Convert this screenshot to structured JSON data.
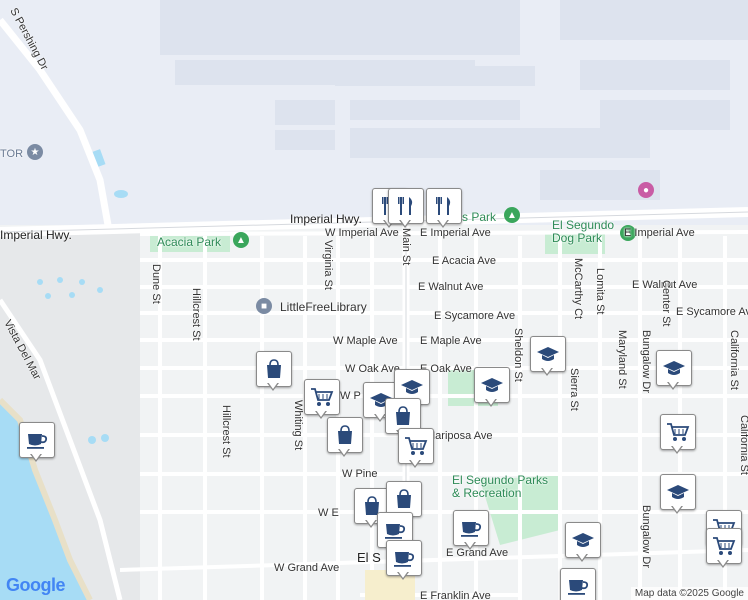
{
  "map": {
    "streets": [
      {
        "id": "s-pershing",
        "name": "S Pershing Dr"
      },
      {
        "id": "imperial-hwy-1",
        "name": "Imperial Hwy."
      },
      {
        "id": "imperial-hwy-2",
        "name": "Imperial Hwy."
      },
      {
        "id": "w-imperial-ave",
        "name": "W Imperial Ave"
      },
      {
        "id": "e-imperial-ave-1",
        "name": "E Imperial Ave"
      },
      {
        "id": "e-imperial-ave-2",
        "name": "E Imperial Ave"
      },
      {
        "id": "main-st",
        "name": "Main St"
      },
      {
        "id": "e-acacia-ave",
        "name": "E Acacia Ave"
      },
      {
        "id": "e-walnut-ave-1",
        "name": "E Walnut Ave"
      },
      {
        "id": "e-walnut-ave-2",
        "name": "E Walnut Ave"
      },
      {
        "id": "e-sycamore-ave-1",
        "name": "E Sycamore Ave"
      },
      {
        "id": "e-sycamore-ave-2",
        "name": "E Sycamore Ave"
      },
      {
        "id": "w-maple-ave",
        "name": "W Maple Ave"
      },
      {
        "id": "e-maple-ave",
        "name": "E Maple Ave"
      },
      {
        "id": "w-oak-ave",
        "name": "W Oak Ave"
      },
      {
        "id": "e-oak-ave",
        "name": "E Oak Ave"
      },
      {
        "id": "w-p",
        "name": "W P"
      },
      {
        "id": "mariposa-ave",
        "name": "Mariposa Ave"
      },
      {
        "id": "w-pine",
        "name": "W Pine"
      },
      {
        "id": "w-grand-ave",
        "name": "W Grand Ave"
      },
      {
        "id": "e-grand-ave",
        "name": "E Grand Ave"
      },
      {
        "id": "e-franklin-ave",
        "name": "E Franklin Ave"
      },
      {
        "id": "dune-st",
        "name": "Dune St"
      },
      {
        "id": "hillcrest-st-1",
        "name": "Hillcrest St"
      },
      {
        "id": "hillcrest-st-2",
        "name": "Hillcrest St"
      },
      {
        "id": "virginia-st",
        "name": "Virginia St"
      },
      {
        "id": "whiting-st",
        "name": "Whiting St"
      },
      {
        "id": "sheldon-st",
        "name": "Sheldon St"
      },
      {
        "id": "mccarthy-ct",
        "name": "McCarthy Ct"
      },
      {
        "id": "lomita-st",
        "name": "Lomita St"
      },
      {
        "id": "sierra-st",
        "name": "Sierra St"
      },
      {
        "id": "maryland-st",
        "name": "Maryland St"
      },
      {
        "id": "bungalow-dr-1",
        "name": "Bungalow Dr"
      },
      {
        "id": "bungalow-dr-2",
        "name": "Bungalow Dr"
      },
      {
        "id": "center-st",
        "name": "Center St"
      },
      {
        "id": "california-st-1",
        "name": "California St"
      },
      {
        "id": "california-st-2",
        "name": "California St"
      },
      {
        "id": "vista-del-mar",
        "name": "Vista Del Mar"
      },
      {
        "id": "w-e-ave",
        "name": "W E"
      }
    ],
    "places": [
      {
        "id": "acacia-park",
        "name": "Acacia Park"
      },
      {
        "id": "dog-park",
        "name": "El Segundo\nDog Park"
      },
      {
        "id": "little-free-library",
        "name": "LittleFreeLibrary"
      },
      {
        "id": "parks-rec",
        "name": "El Segundo Parks\n& Recreation"
      },
      {
        "id": "s-park",
        "name": "s Park"
      },
      {
        "id": "el-segundo-center",
        "name": "El S"
      },
      {
        "id": "tor",
        "name": "TOR"
      }
    ],
    "attribution": "Map data ©2025 Google",
    "logo": "Google",
    "colors": {
      "water": "#a7dcf5",
      "park": "#c8ecd3",
      "road": "#ffffff",
      "airport": "#e9edf5",
      "land": "#f1f3f4",
      "marker_icon": "#2b4a7a"
    },
    "markers": [
      {
        "type": "restaurant-icon",
        "label": "restaurant"
      },
      {
        "type": "restaurant-icon",
        "label": "restaurant"
      },
      {
        "type": "restaurant-icon",
        "label": "restaurant"
      },
      {
        "type": "shopping-bag-icon",
        "label": "store"
      },
      {
        "type": "shopping-cart-icon",
        "label": "grocery"
      },
      {
        "type": "school-icon",
        "label": "school"
      },
      {
        "type": "school-icon",
        "label": "school"
      },
      {
        "type": "school-icon",
        "label": "school"
      },
      {
        "type": "school-icon",
        "label": "school"
      },
      {
        "type": "shopping-bag-icon",
        "label": "store"
      },
      {
        "type": "shopping-bag-icon",
        "label": "store"
      },
      {
        "type": "shopping-cart-icon",
        "label": "grocery"
      },
      {
        "type": "cafe-icon",
        "label": "cafe"
      },
      {
        "type": "school-icon",
        "label": "school"
      },
      {
        "type": "shopping-cart-icon",
        "label": "grocery"
      },
      {
        "type": "school-icon",
        "label": "school"
      },
      {
        "type": "shopping-bag-icon",
        "label": "store"
      },
      {
        "type": "shopping-bag-icon",
        "label": "store"
      },
      {
        "type": "cafe-icon",
        "label": "cafe"
      },
      {
        "type": "cafe-icon",
        "label": "cafe"
      },
      {
        "type": "cafe-icon",
        "label": "cafe"
      },
      {
        "type": "school-icon",
        "label": "school"
      },
      {
        "type": "cafe-icon",
        "label": "cafe"
      },
      {
        "type": "shopping-cart-icon",
        "label": "grocery"
      },
      {
        "type": "shopping-cart-icon",
        "label": "grocery"
      }
    ]
  }
}
